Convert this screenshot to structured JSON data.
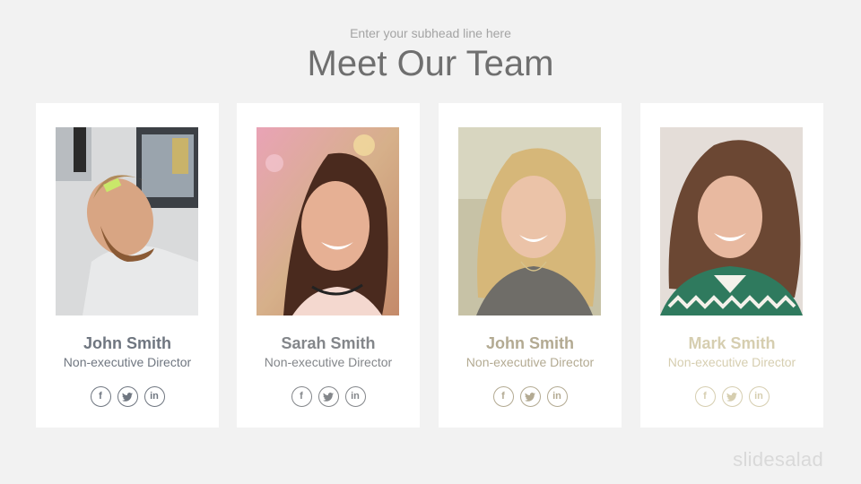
{
  "header": {
    "subhead": "Enter your subhead line here",
    "title": "Meet Our Team"
  },
  "members": [
    {
      "name": "John Smith",
      "role": "Non-executive Director",
      "color": "#6f7680"
    },
    {
      "name": "Sarah Smith",
      "role": "Non-executive Director",
      "color": "#83868a"
    },
    {
      "name": "John Smith",
      "role": "Non-executive Director",
      "color": "#b3aa92"
    },
    {
      "name": "Mark Smith",
      "role": "Non-executive Director",
      "color": "#d6ceb0"
    }
  ],
  "social_icons": [
    "facebook-icon",
    "twitter-icon",
    "linkedin-icon"
  ],
  "social_glyphs": {
    "facebook": "f",
    "linkedin": "in"
  },
  "watermark": "slidesalad"
}
